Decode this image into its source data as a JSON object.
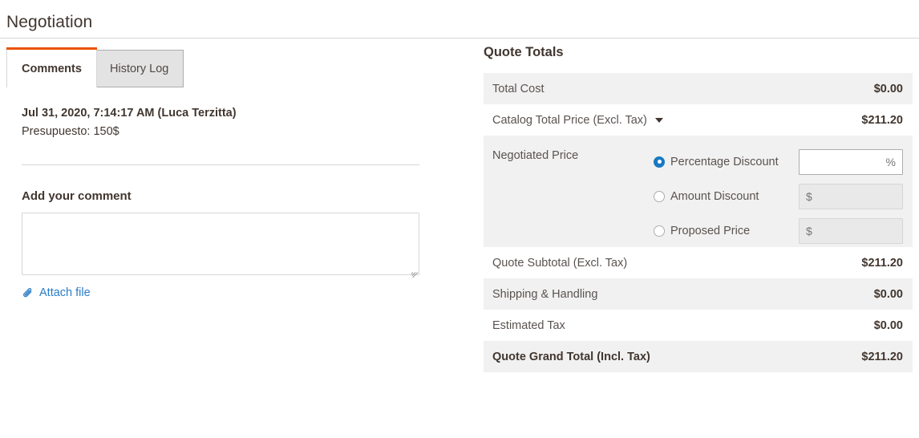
{
  "page": {
    "title": "Negotiation"
  },
  "tabs": [
    {
      "label": "Comments",
      "active": true
    },
    {
      "label": "History Log",
      "active": false
    }
  ],
  "comments": {
    "entries": [
      {
        "meta": "Jul 31, 2020, 7:14:17 AM (Luca Terzitta)",
        "body": "Presupuesto: 150$"
      }
    ],
    "add_label": "Add your comment",
    "textarea_value": "",
    "textarea_placeholder": "",
    "attach_label": "Attach file",
    "attach_icon": "paperclip-icon",
    "link_color": "#2a7cc7"
  },
  "quote_totals": {
    "heading": "Quote Totals",
    "rows": [
      {
        "label": "Total Cost",
        "value": "$0.00",
        "shade": true,
        "bold": false
      },
      {
        "label": "Catalog Total Price (Excl. Tax)",
        "value": "$211.20",
        "shade": false,
        "bold": false,
        "caret": "chevron-down-icon"
      },
      {
        "label": "Quote Subtotal (Excl. Tax)",
        "value": "$211.20",
        "shade": false,
        "bold": false
      },
      {
        "label": "Shipping & Handling",
        "value": "$0.00",
        "shade": true,
        "bold": false
      },
      {
        "label": "Estimated Tax",
        "value": "$0.00",
        "shade": false,
        "bold": false
      },
      {
        "label": "Quote Grand Total (Incl. Tax)",
        "value": "$211.20",
        "shade": true,
        "bold": true
      }
    ],
    "negotiated_price": {
      "label": "Negotiated Price",
      "options": [
        {
          "label": "Percentage Discount",
          "checked": true,
          "input_value": "",
          "input_placeholder": "%",
          "enabled": true
        },
        {
          "label": "Amount Discount",
          "checked": false,
          "input_value": "",
          "input_placeholder": "$",
          "enabled": false
        },
        {
          "label": "Proposed Price",
          "checked": false,
          "input_value": "",
          "input_placeholder": "$",
          "enabled": false
        }
      ]
    }
  },
  "colors": {
    "accent": "#eb5202",
    "radio_selected": "#1979c3",
    "row_shade": "#f1f1f1",
    "text": "#41362f",
    "muted_text": "#5a5350"
  }
}
